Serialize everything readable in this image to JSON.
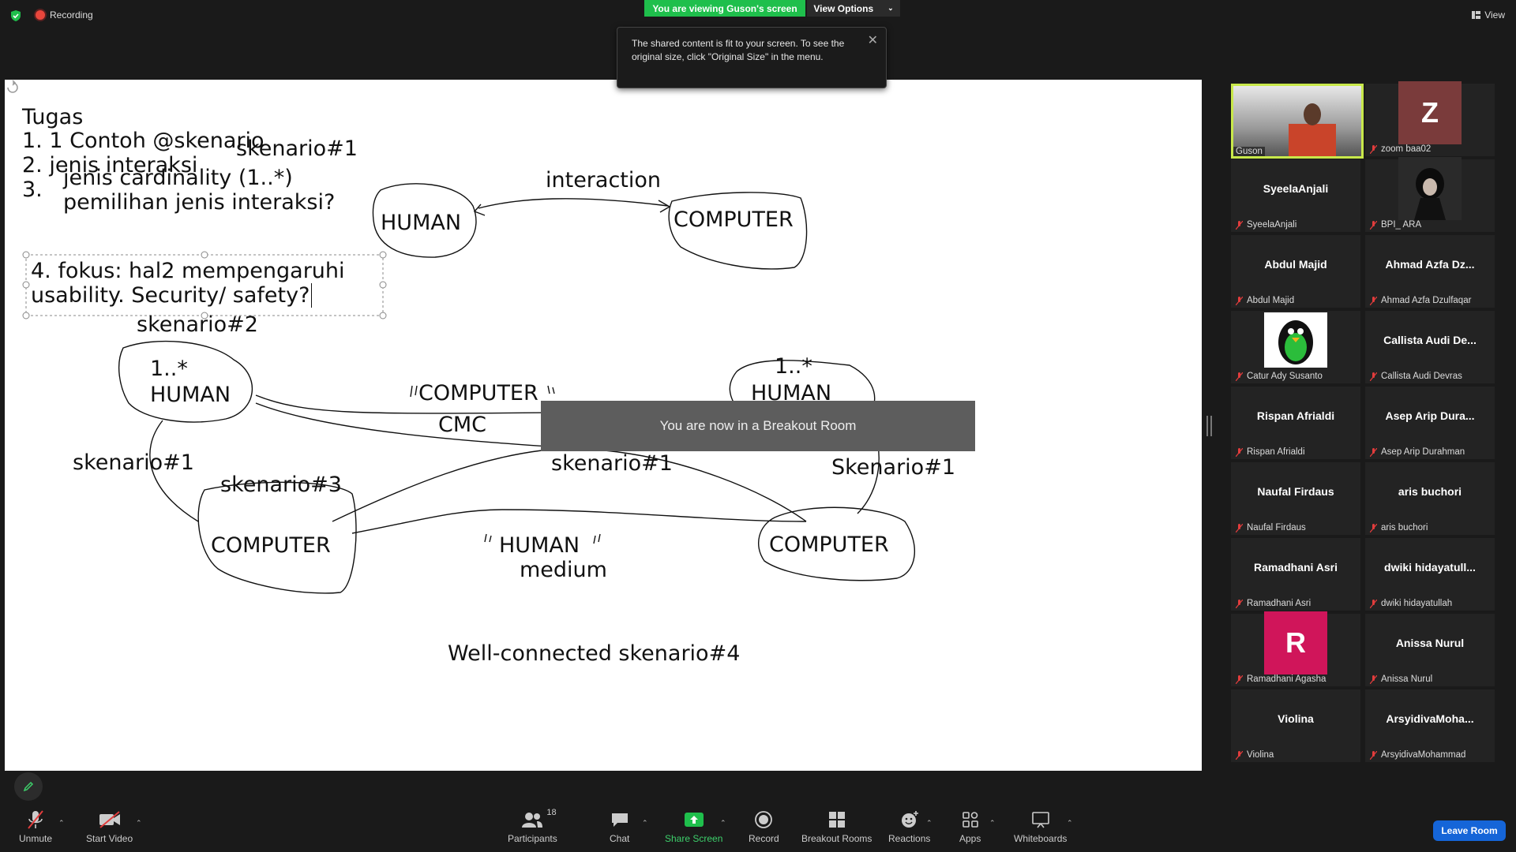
{
  "topbar": {
    "recording_label": "Recording",
    "viewing_label": "You are viewing Guson's screen",
    "view_options_label": "View Options",
    "view_label": "View"
  },
  "tooltip": {
    "text": "The shared content is fit to your screen. To see the original size, click \"Original Size\" in the menu."
  },
  "whiteboard": {
    "task_title": "Tugas",
    "task_1": "1. 1 Contoh @skenario",
    "task_2": "2. jenis interaksi",
    "task_3_num": "3.",
    "task_3_line1": "jenis cardinality (1..*)",
    "task_3_line2": "pemilihan jenis interaksi?",
    "task_4_line1": "4. fokus: hal2 mempengaruhi",
    "task_4_line2": "usability. Security/ safety?",
    "sk1_top": "skenario#1",
    "human_top": "HUMAN",
    "interaction": "interaction",
    "computer_top": "COMPUTER",
    "sk2": "skenario#2",
    "one_star_left": "1..*",
    "human_left": "HUMAN",
    "computer_mid": "COMPUTER",
    "cmc": "CMC",
    "one_star_right": "1..*",
    "human_right": "HUMAN",
    "sk1_left": "skenario#1",
    "sk3": "skenario#3",
    "sk1_mid": "skenario#1",
    "Sk1_right": "Skenario#1",
    "computer_bl": "COMPUTER",
    "human_medium": "HUMAN",
    "medium": "medium",
    "computer_br": "COMPUTER",
    "sk4": "Well-connected skenario#4"
  },
  "breakout_banner": "You are now in a Breakout Room",
  "participants": [
    {
      "display": "",
      "name": "Guson",
      "type": "video"
    },
    {
      "display": "Z",
      "name": "zoom baa02",
      "type": "avatar",
      "color": "#7a3b3b"
    },
    {
      "display": "SyeelaAnjali",
      "name": "SyeelaAnjali",
      "type": "text"
    },
    {
      "display": "",
      "name": "BPI_ ARA",
      "type": "image"
    },
    {
      "display": "Abdul Majid",
      "name": "Abdul Majid",
      "type": "text"
    },
    {
      "display": "Ahmad Azfa Dz...",
      "name": "Ahmad Azfa Dzulfaqar",
      "type": "text"
    },
    {
      "display": "",
      "name": "Catur Ady Susanto",
      "type": "penguin"
    },
    {
      "display": "Callista Audi De...",
      "name": "Callista Audi Devras",
      "type": "text"
    },
    {
      "display": "Rispan Afrialdi",
      "name": "Rispan Afrialdi",
      "type": "text"
    },
    {
      "display": "Asep Arip Dura...",
      "name": "Asep Arip Durahman",
      "type": "text"
    },
    {
      "display": "Naufal Firdaus",
      "name": "Naufal Firdaus",
      "type": "text"
    },
    {
      "display": "aris buchori",
      "name": "aris buchori",
      "type": "text"
    },
    {
      "display": "Ramadhani Asri",
      "name": "Ramadhani Asri",
      "type": "text"
    },
    {
      "display": "dwiki  hidayatull...",
      "name": "dwiki hidayatullah",
      "type": "text"
    },
    {
      "display": "R",
      "name": "Ramadhani Agasha",
      "type": "avatar",
      "color": "#d0155a"
    },
    {
      "display": "Anissa Nurul",
      "name": "Anissa Nurul",
      "type": "text"
    },
    {
      "display": "Violina",
      "name": "Violina",
      "type": "text"
    },
    {
      "display": "ArsyidivaMoha...",
      "name": "ArsyidivaMohammad",
      "type": "text"
    }
  ],
  "toolbar": {
    "unmute": "Unmute",
    "start_video": "Start Video",
    "participants": "Participants",
    "participants_count": "18",
    "chat": "Chat",
    "share_screen": "Share Screen",
    "record": "Record",
    "breakout_rooms": "Breakout Rooms",
    "reactions": "Reactions",
    "apps": "Apps",
    "whiteboards": "Whiteboards",
    "leave_room": "Leave Room"
  },
  "colors": {
    "green": "#1fbf4c",
    "leave_blue": "#1565d8",
    "active_speaker": "#c8e84a"
  }
}
